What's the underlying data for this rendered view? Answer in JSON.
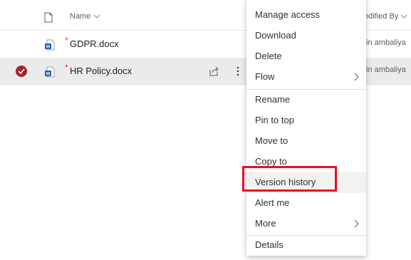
{
  "header": {
    "name_label": "Name",
    "modified_by_label": "odified By"
  },
  "files": [
    {
      "name": "GDPR.docx",
      "modified_by": "tin ambaliya",
      "selected": false
    },
    {
      "name": "HR Policy.docx",
      "modified_by": "tin ambaliya",
      "selected": true
    }
  ],
  "menu": {
    "items": [
      {
        "label": "Manage access"
      },
      {
        "label": "Download"
      },
      {
        "label": "Delete"
      },
      {
        "label": "Flow",
        "has_submenu": true
      },
      {
        "label": "Rename"
      },
      {
        "label": "Pin to top"
      },
      {
        "label": "Move to"
      },
      {
        "label": "Copy to"
      },
      {
        "label": "Version history",
        "annotated": true
      },
      {
        "label": "Alert me"
      },
      {
        "label": "More",
        "has_submenu": true
      },
      {
        "label": "Details"
      }
    ]
  },
  "colors": {
    "selected_check": "#a4262c",
    "annotation_box": "#e81123",
    "word_blue": "#185abd"
  },
  "icons": {
    "file_header": "file-outline-icon",
    "doc": "word-document-icon",
    "share": "share-icon",
    "more": "more-vertical-icon",
    "submenu": "chevron-right-icon",
    "check": "checkmark-circle-icon"
  }
}
